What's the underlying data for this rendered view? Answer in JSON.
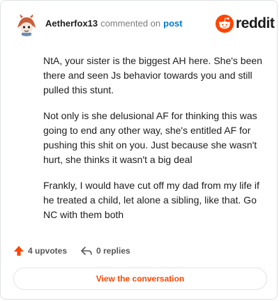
{
  "header": {
    "username": "Aetherfox13",
    "action_text": "commented on",
    "post_link": "post",
    "brand_name": "reddit"
  },
  "comment": {
    "paragraphs": [
      "NtA, your sister is the biggest AH here. She's been there and seen Js behavior towards you and still pulled this stunt.",
      "Not only is she delusional AF for thinking this was going to end any other way, she's entitled AF for pushing this shit on you. Just because she wasn't hurt, she thinks it wasn't a big deal",
      "Frankly, I would have cut off my dad from my life if he treated a child, let alone a sibling, like that. Go NC with them both"
    ]
  },
  "actions": {
    "upvotes": "4 upvotes",
    "replies": "0 replies",
    "upvote_icon": "upvote-arrow-icon",
    "reply_icon": "reply-arrow-icon"
  },
  "cta": {
    "label": "View the conversation"
  },
  "colors": {
    "brand": "#ff4500",
    "link": "#0079d3",
    "text": "#1c1c1c",
    "muted": "#7c7c7c"
  }
}
